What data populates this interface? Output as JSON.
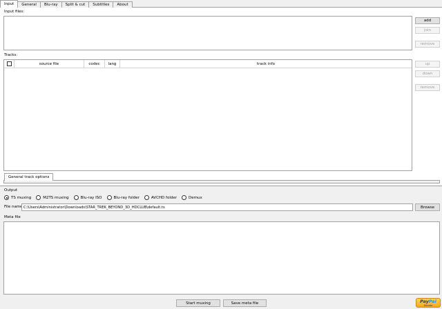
{
  "tabs": [
    {
      "label": "Input"
    },
    {
      "label": "General"
    },
    {
      "label": "Blu-ray"
    },
    {
      "label": "Split & cut"
    },
    {
      "label": "Subtitles"
    },
    {
      "label": "About"
    }
  ],
  "input_files": {
    "label": "Input files:",
    "buttons": {
      "add": "add",
      "join": "join",
      "remove": "remove"
    }
  },
  "tracks": {
    "label": "Tracks:",
    "columns": [
      "source file",
      "codec",
      "lang",
      "track info"
    ],
    "buttons": {
      "up": "up",
      "down": "down",
      "remove": "remove"
    },
    "options_tab": "General track options"
  },
  "output": {
    "label": "Output",
    "options": [
      {
        "label": "TS muxing",
        "selected": true
      },
      {
        "label": "M2TS muxing",
        "selected": false
      },
      {
        "label": "Blu-ray ISO",
        "selected": false
      },
      {
        "label": "Blu-ray folder",
        "selected": false
      },
      {
        "label": "AVCHD folder",
        "selected": false
      },
      {
        "label": "Demux",
        "selected": false
      }
    ],
    "file_name_label": "File name",
    "file_name_value": "C:\\Users\\Administrator\\Downloads\\STAR_TREK_BEYOND_3D_HDCLUB\\default.ts",
    "browse": "Browse"
  },
  "meta": {
    "label": "Meta file"
  },
  "footer": {
    "start": "Start muxing",
    "save": "Save meta file",
    "paypal_pay1": "Pay",
    "paypal_pay2": "Pal",
    "paypal_donate": "Donate"
  }
}
